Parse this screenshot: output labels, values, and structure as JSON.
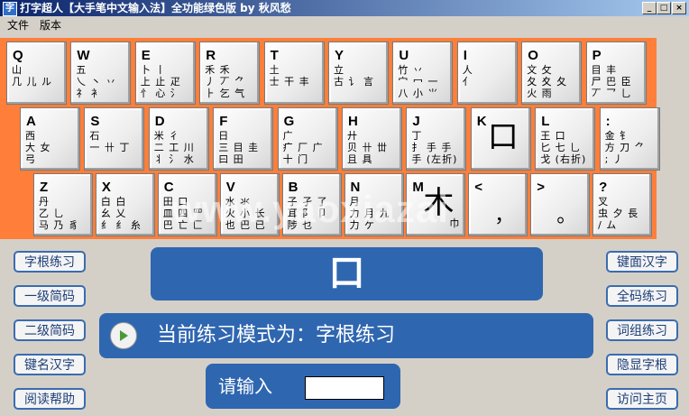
{
  "window": {
    "title": "打字超人【大手笔中文输入法】全功能绿色版 by 秋风愁",
    "app_icon": "字",
    "controls": {
      "minimize": "_",
      "maximize": "□",
      "close": "×"
    }
  },
  "menu": {
    "file": "文件",
    "version": "版本"
  },
  "keyboard": {
    "row1": [
      {
        "letter": "Q",
        "roots": "山\n几 儿 ル"
      },
      {
        "letter": "W",
        "roots": "五\n乀 丶 丷\n礻 衤"
      },
      {
        "letter": "E",
        "roots": "卜 丨\n上 止 疋\n忄 心 氵"
      },
      {
        "letter": "R",
        "roots": "禾 禾\n丿 丆 ⺈\n⺊ 乞 气"
      },
      {
        "letter": "T",
        "roots": "土\n士 干 丰"
      },
      {
        "letter": "Y",
        "roots": "立\n古 讠 言"
      },
      {
        "letter": "U",
        "roots": "竹 丷\n宀 冖 一\n八 小 ⺌"
      },
      {
        "letter": "I",
        "roots": "人\n亻"
      },
      {
        "letter": "O",
        "roots": "文 攵\n夂 夊 夂\n火 雨"
      },
      {
        "letter": "P",
        "roots": "目 丰\n尸 巴 臣\n丆 乛 ⺃"
      }
    ],
    "row2": [
      {
        "letter": "A",
        "roots": "西\n大 女\n弓"
      },
      {
        "letter": "S",
        "roots": "石\n一 卄 丁"
      },
      {
        "letter": "D",
        "roots": "米 彳\n二 工 川\n丬 氵 水"
      },
      {
        "letter": "F",
        "roots": "日\n三 目 圭\n曰 田"
      },
      {
        "letter": "G",
        "roots": "广\n疒 厂 广\n十 门"
      },
      {
        "letter": "H",
        "roots": "廾\n贝 卄 丗\n且 具"
      },
      {
        "letter": "J",
        "roots": "丁\n扌 手 手\n手 (左折)"
      },
      {
        "letter": "K",
        "big": "口"
      },
      {
        "letter": "L",
        "roots": "王 口\n匕 七 乚\n戈 (右折)"
      },
      {
        "letter": ":",
        "roots": "金 钅\n方 刀 ⺈\n; 丿"
      }
    ],
    "row3": [
      {
        "letter": "Z",
        "roots": "丹\n乙 乚\n马 乃 豸"
      },
      {
        "letter": "X",
        "roots": "白 白\n幺 乂\n纟 纟 糸"
      },
      {
        "letter": "C",
        "roots": "田 口\n皿 四 罒\n巴 亡 匚"
      },
      {
        "letter": "V",
        "roots": "水 氺\n火 小 长\n也 巴 已"
      },
      {
        "letter": "B",
        "roots": "子 孑 了\n耳 阝 卩\n陟 乜"
      },
      {
        "letter": "N",
        "roots": "月\n力 月 九\n力 ケ"
      },
      {
        "letter": "M",
        "big": "木",
        "small": "巾"
      },
      {
        "letter": "<",
        "punct": "，"
      },
      {
        "letter": ">",
        "punct": "。"
      },
      {
        "letter": "?",
        "roots": "叉\n虫 夕 長\n/ ム"
      }
    ]
  },
  "watermark": "www.yaoxiazai",
  "left_buttons": [
    "字根练习",
    "一级简码",
    "二级简码",
    "键名汉字",
    "阅读帮助"
  ],
  "right_buttons": [
    "键面汉字",
    "全码练习",
    "词组练习",
    "隐显字根",
    "访问主页"
  ],
  "practice": {
    "current_char": "口",
    "mode_text": "当前练习模式为：字根练习",
    "input_label": "请输入",
    "input_value": ""
  },
  "colors": {
    "keyboard_bg": "#ff7f3a",
    "panel": "#2f66b0",
    "titlebar": "#0a246a"
  }
}
